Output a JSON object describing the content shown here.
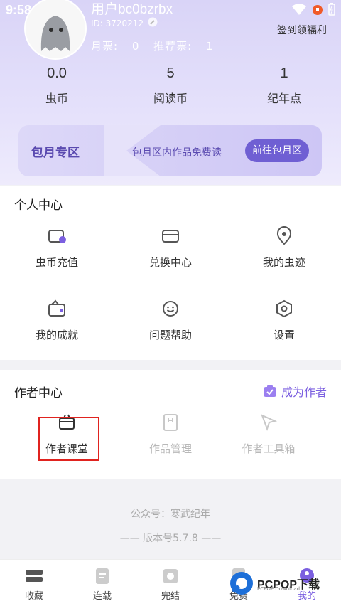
{
  "status_bar": {
    "time": "9:58"
  },
  "profile": {
    "username": "用户bc0bzrbx",
    "user_id": "ID: 3720212",
    "monthly_ticket_label": "月票:",
    "monthly_ticket_value": "0",
    "recommend_ticket_label": "推荐票:",
    "recommend_ticket_value": "1",
    "signin_label": "签到领福利"
  },
  "stats": [
    {
      "value": "0.0",
      "label": "虫币"
    },
    {
      "value": "5",
      "label": "阅读币"
    },
    {
      "value": "1",
      "label": "纪年点"
    }
  ],
  "monthly_zone": {
    "title": "包月专区",
    "description": "包月区内作品免费读",
    "button": "前往包月区"
  },
  "personal_center": {
    "title": "个人中心",
    "items": [
      {
        "label": "虫币充值",
        "icon": "wallet-coin-icon"
      },
      {
        "label": "兑换中心",
        "icon": "card-icon"
      },
      {
        "label": "我的虫迹",
        "icon": "location-pin-icon"
      },
      {
        "label": "我的成就",
        "icon": "bag-icon"
      },
      {
        "label": "问题帮助",
        "icon": "smile-icon"
      },
      {
        "label": "设置",
        "icon": "hexagon-settings-icon"
      }
    ]
  },
  "author_center": {
    "title": "作者中心",
    "become_author": "成为作者",
    "items": [
      {
        "label": "作者课堂",
        "icon": "box-icon",
        "enabled": true
      },
      {
        "label": "作品管理",
        "icon": "book-icon",
        "enabled": false
      },
      {
        "label": "作者工具箱",
        "icon": "cursor-icon",
        "enabled": false
      }
    ]
  },
  "footer": {
    "account": "公众号：寒武纪年",
    "version": "—— 版本号5.7.8 ——"
  },
  "tabbar": [
    {
      "label": "收藏"
    },
    {
      "label": "连载"
    },
    {
      "label": "完结"
    },
    {
      "label": "免费"
    },
    {
      "label": "我的"
    }
  ],
  "watermark": {
    "text": "PCPOP下载",
    "sub": "PCPOP Download"
  },
  "colors": {
    "accent": "#7b5fe0",
    "highlight": "#e0231f",
    "header": "#d9d4f7"
  }
}
